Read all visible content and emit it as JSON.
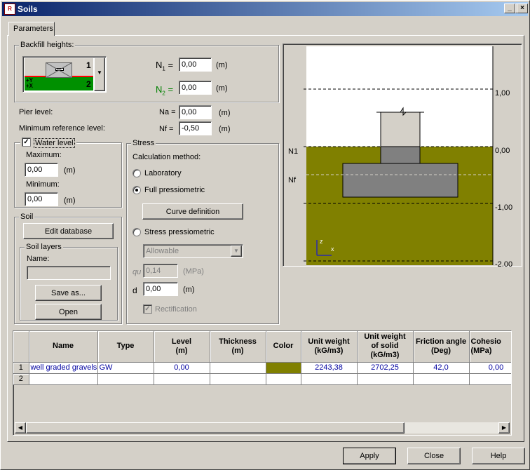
{
  "window": {
    "title": "Soils",
    "icon": "app-icon"
  },
  "tabs": [
    {
      "label": "Parameters"
    }
  ],
  "backfill": {
    "group_label": "Backfill heights:",
    "preview_labels": {
      "top_right": "1",
      "bottom_right": "2",
      "axis": "+Y\n+X"
    },
    "n1_symbol": "N",
    "n1_sub": "1",
    "n2_symbol": "N",
    "n2_sub": "2",
    "n1_value": "0,00",
    "n2_value": "0,00",
    "unit": "(m)"
  },
  "levels": {
    "pier_label": "Pier level:",
    "pier_symbol": "Na =",
    "pier_value": "0,00",
    "minref_label": "Minimum reference level:",
    "minref_symbol": "Nf =",
    "minref_value": "-0,50",
    "unit": "(m)"
  },
  "water": {
    "checkbox_label": "Water level",
    "checked": true,
    "maximum_label": "Maximum:",
    "maximum_value": "0,00",
    "minimum_label": "Minimum:",
    "minimum_value": "0,00",
    "unit": "(m)"
  },
  "soil": {
    "group_label": "Soil",
    "edit_db_label": "Edit database",
    "layers_label": "Soil layers",
    "name_label": "Name:",
    "name_value": "",
    "save_as_label": "Save as...",
    "open_label": "Open"
  },
  "stress": {
    "group_label": "Stress",
    "calc_label": "Calculation method:",
    "laboratory_label": "Laboratory",
    "full_label": "Full pressiometric",
    "selected": "full",
    "curve_label": "Curve definition",
    "stress_press_label": "Stress pressiometric",
    "allowable_value": "Allowable",
    "qu_label": "qu",
    "qu_value": "0,14",
    "qu_unit": "(MPa)",
    "d_label": "d",
    "d_value": "0,00",
    "d_unit": "(m)",
    "rectification_label": "Rectification",
    "rectification_checked": true
  },
  "preview": {
    "soil_color": "#808000",
    "footing_color": "#808080",
    "labels": {
      "n1": "N1",
      "nf": "Nf"
    },
    "ticks": [
      "1,00",
      "0,00",
      "-1,00",
      "-2,00"
    ],
    "axis_z": "z",
    "axis_x": "x"
  },
  "table": {
    "columns": [
      {
        "key": "name",
        "label": "Name"
      },
      {
        "key": "type",
        "label": "Type"
      },
      {
        "key": "level",
        "label": "Level\n(m)"
      },
      {
        "key": "thickness",
        "label": "Thickness\n(m)"
      },
      {
        "key": "color",
        "label": "Color"
      },
      {
        "key": "unit_weight",
        "label": "Unit weight\n(kG/m3)"
      },
      {
        "key": "unit_weight_solid",
        "label": "Unit weight\nof solid\n(kG/m3)"
      },
      {
        "key": "friction",
        "label": "Friction angle\n(Deg)"
      },
      {
        "key": "cohesion",
        "label": "Cohesio\n(MPa)"
      }
    ],
    "rows": [
      {
        "index": "1",
        "name": "well graded gravels",
        "type": "GW",
        "level": "0,00",
        "thickness": "",
        "color": "#808000",
        "unit_weight": "2243,38",
        "unit_weight_solid": "2702,25",
        "friction": "42,0",
        "cohesion": "0,00"
      },
      {
        "index": "2",
        "name": "",
        "type": "",
        "level": "",
        "thickness": "",
        "color": "",
        "unit_weight": "",
        "unit_weight_solid": "",
        "friction": "",
        "cohesion": ""
      }
    ]
  },
  "footer": {
    "apply_label": "Apply",
    "close_label": "Close",
    "help_label": "Help"
  }
}
